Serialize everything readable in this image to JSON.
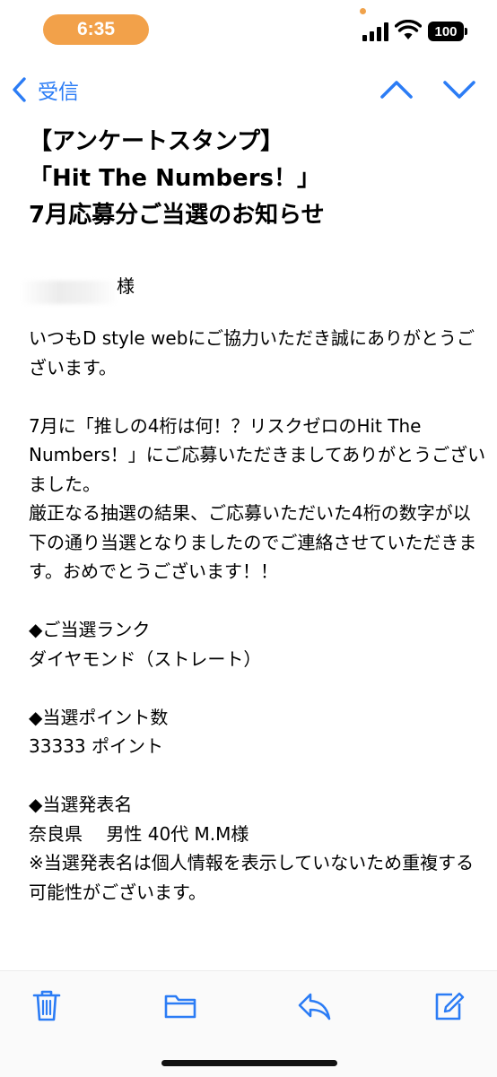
{
  "status_bar": {
    "time": "6:35",
    "battery": "100"
  },
  "nav": {
    "back_label": "受信"
  },
  "email": {
    "subject_lines": [
      "【アンケートスタンプ】",
      "「Hit The Numbers！」",
      "7月応募分ご当選のお知らせ"
    ],
    "honorific": "様",
    "greeting": "いつもD style webにご協力いただき誠にありがとうございます。",
    "para1": "7月に「推しの4桁は何！？リスクゼロのHit The Numbers！」にご応募いただきましてありがとうございました。",
    "para2": "厳正なる抽選の結果、ご応募いただいた4桁の数字が以下の通り当選となりましたのでご連絡させていただきます。おめでとうございます！！",
    "rank_heading": "◆ご当選ランク",
    "rank_value": "ダイヤモンド（ストレート）",
    "points_heading": "◆当選ポイント数",
    "points_value": "33333 ポイント",
    "announce_heading": "◆当選発表名",
    "announce_value": "奈良県　 男性 40代 M.M様",
    "note": "※当選発表名は個人情報を表示していないため重複する可能性がございます。"
  },
  "icons": {
    "back": "chevron-left-icon",
    "up": "chevron-up-icon",
    "down": "chevron-down-icon",
    "trash": "trash-icon",
    "folder": "folder-icon",
    "reply": "reply-icon",
    "compose": "compose-icon"
  },
  "colors": {
    "accent": "#2b7cf5",
    "time_pill": "#f2a14a"
  }
}
